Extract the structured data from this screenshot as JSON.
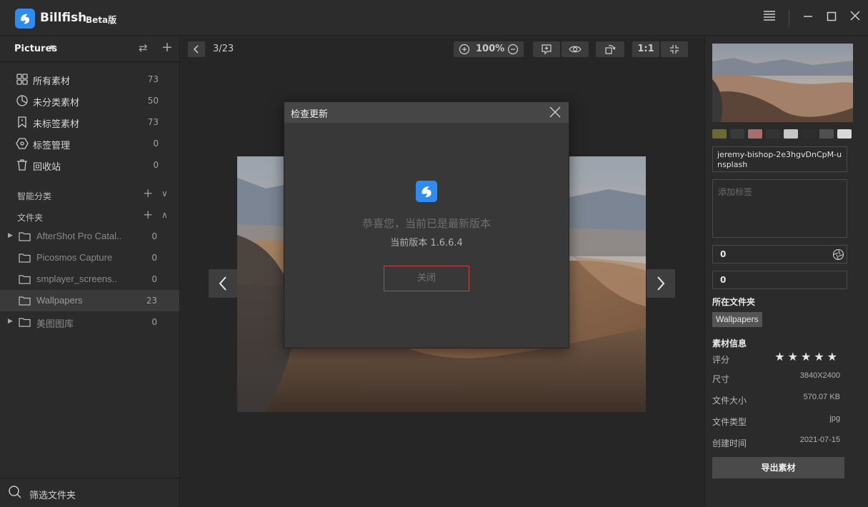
{
  "app": {
    "name": "Billfish",
    "badge": "Beta版"
  },
  "library": {
    "title": "Pictures"
  },
  "nav": [
    {
      "label": "所有素材",
      "count": "73",
      "icon": "grid-icon"
    },
    {
      "label": "未分类素材",
      "count": "50",
      "icon": "pie-icon"
    },
    {
      "label": "未标签素材",
      "count": "73",
      "icon": "untagged-icon"
    },
    {
      "label": "标签管理",
      "count": "0",
      "icon": "tag-icon"
    },
    {
      "label": "回收站",
      "count": "0",
      "icon": "trash-icon"
    }
  ],
  "sections": {
    "smart": "智能分类",
    "folders": "文件夹"
  },
  "folders": [
    {
      "label": "AfterShot Pro Catal..",
      "count": "0",
      "expandable": true
    },
    {
      "label": "Picosmos Capture",
      "count": "0",
      "expandable": false
    },
    {
      "label": "smplayer_screens..",
      "count": "0",
      "expandable": false
    },
    {
      "label": "Wallpapers",
      "count": "23",
      "expandable": false,
      "selected": true
    },
    {
      "label": "美图图库",
      "count": "0",
      "expandable": true
    }
  ],
  "filter": {
    "label": "筛选文件夹"
  },
  "viewer": {
    "page": "3/23",
    "zoom": "100%",
    "actual_size": "1:1"
  },
  "modal": {
    "title": "检查更新",
    "message": "恭喜您，当前已是最新版本",
    "version": "当前版本 1.6.6.4",
    "button": "关闭"
  },
  "details": {
    "swatches": [
      "#6b6a35",
      "#3a3a3a",
      "#a86d6f",
      "#343434",
      "#c6c6c6",
      "#2e2e2e",
      "#505050",
      "#d9d9d9"
    ],
    "filename": "jeremy-bishop-2e3hgvDnCpM-unsplash",
    "tag_placeholder": "添加标签",
    "field1": "0",
    "field2": "0",
    "folder_label": "所在文件夹",
    "folder_chip": "Wallpapers",
    "info_label": "素材信息",
    "rating_label": "评分",
    "rating_stars": "★★★★★",
    "rows": [
      {
        "key": "尺寸",
        "value": "3840X2400"
      },
      {
        "key": "文件大小",
        "value": "570.07 KB"
      },
      {
        "key": "文件类型",
        "value": "jpg"
      },
      {
        "key": "创建时间",
        "value": "2021-07-15"
      }
    ],
    "export": "导出素材"
  }
}
